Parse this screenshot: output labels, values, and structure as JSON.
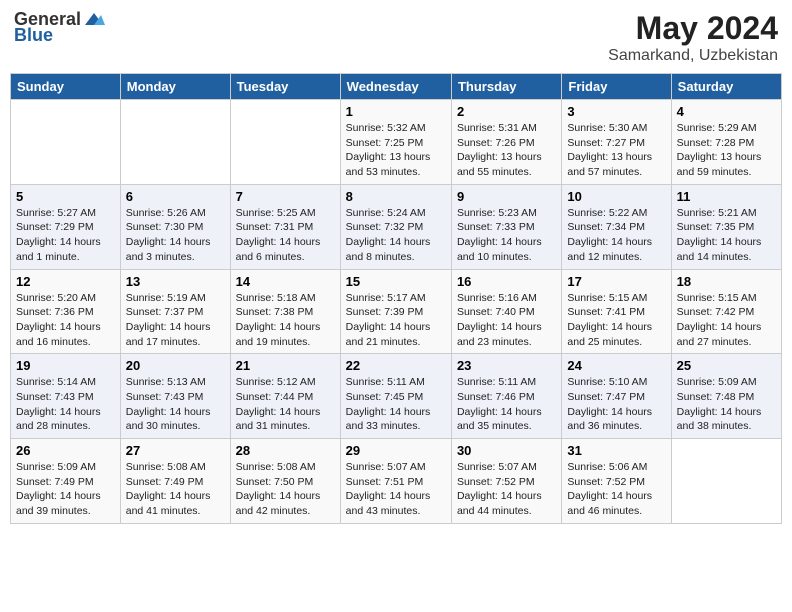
{
  "logo": {
    "general": "General",
    "blue": "Blue"
  },
  "title": "May 2024",
  "location": "Samarkand, Uzbekistan",
  "headers": [
    "Sunday",
    "Monday",
    "Tuesday",
    "Wednesday",
    "Thursday",
    "Friday",
    "Saturday"
  ],
  "weeks": [
    [
      {
        "day": "",
        "sunrise": "",
        "sunset": "",
        "daylight": ""
      },
      {
        "day": "",
        "sunrise": "",
        "sunset": "",
        "daylight": ""
      },
      {
        "day": "",
        "sunrise": "",
        "sunset": "",
        "daylight": ""
      },
      {
        "day": "1",
        "sunrise": "Sunrise: 5:32 AM",
        "sunset": "Sunset: 7:25 PM",
        "daylight": "Daylight: 13 hours and 53 minutes."
      },
      {
        "day": "2",
        "sunrise": "Sunrise: 5:31 AM",
        "sunset": "Sunset: 7:26 PM",
        "daylight": "Daylight: 13 hours and 55 minutes."
      },
      {
        "day": "3",
        "sunrise": "Sunrise: 5:30 AM",
        "sunset": "Sunset: 7:27 PM",
        "daylight": "Daylight: 13 hours and 57 minutes."
      },
      {
        "day": "4",
        "sunrise": "Sunrise: 5:29 AM",
        "sunset": "Sunset: 7:28 PM",
        "daylight": "Daylight: 13 hours and 59 minutes."
      }
    ],
    [
      {
        "day": "5",
        "sunrise": "Sunrise: 5:27 AM",
        "sunset": "Sunset: 7:29 PM",
        "daylight": "Daylight: 14 hours and 1 minute."
      },
      {
        "day": "6",
        "sunrise": "Sunrise: 5:26 AM",
        "sunset": "Sunset: 7:30 PM",
        "daylight": "Daylight: 14 hours and 3 minutes."
      },
      {
        "day": "7",
        "sunrise": "Sunrise: 5:25 AM",
        "sunset": "Sunset: 7:31 PM",
        "daylight": "Daylight: 14 hours and 6 minutes."
      },
      {
        "day": "8",
        "sunrise": "Sunrise: 5:24 AM",
        "sunset": "Sunset: 7:32 PM",
        "daylight": "Daylight: 14 hours and 8 minutes."
      },
      {
        "day": "9",
        "sunrise": "Sunrise: 5:23 AM",
        "sunset": "Sunset: 7:33 PM",
        "daylight": "Daylight: 14 hours and 10 minutes."
      },
      {
        "day": "10",
        "sunrise": "Sunrise: 5:22 AM",
        "sunset": "Sunset: 7:34 PM",
        "daylight": "Daylight: 14 hours and 12 minutes."
      },
      {
        "day": "11",
        "sunrise": "Sunrise: 5:21 AM",
        "sunset": "Sunset: 7:35 PM",
        "daylight": "Daylight: 14 hours and 14 minutes."
      }
    ],
    [
      {
        "day": "12",
        "sunrise": "Sunrise: 5:20 AM",
        "sunset": "Sunset: 7:36 PM",
        "daylight": "Daylight: 14 hours and 16 minutes."
      },
      {
        "day": "13",
        "sunrise": "Sunrise: 5:19 AM",
        "sunset": "Sunset: 7:37 PM",
        "daylight": "Daylight: 14 hours and 17 minutes."
      },
      {
        "day": "14",
        "sunrise": "Sunrise: 5:18 AM",
        "sunset": "Sunset: 7:38 PM",
        "daylight": "Daylight: 14 hours and 19 minutes."
      },
      {
        "day": "15",
        "sunrise": "Sunrise: 5:17 AM",
        "sunset": "Sunset: 7:39 PM",
        "daylight": "Daylight: 14 hours and 21 minutes."
      },
      {
        "day": "16",
        "sunrise": "Sunrise: 5:16 AM",
        "sunset": "Sunset: 7:40 PM",
        "daylight": "Daylight: 14 hours and 23 minutes."
      },
      {
        "day": "17",
        "sunrise": "Sunrise: 5:15 AM",
        "sunset": "Sunset: 7:41 PM",
        "daylight": "Daylight: 14 hours and 25 minutes."
      },
      {
        "day": "18",
        "sunrise": "Sunrise: 5:15 AM",
        "sunset": "Sunset: 7:42 PM",
        "daylight": "Daylight: 14 hours and 27 minutes."
      }
    ],
    [
      {
        "day": "19",
        "sunrise": "Sunrise: 5:14 AM",
        "sunset": "Sunset: 7:43 PM",
        "daylight": "Daylight: 14 hours and 28 minutes."
      },
      {
        "day": "20",
        "sunrise": "Sunrise: 5:13 AM",
        "sunset": "Sunset: 7:43 PM",
        "daylight": "Daylight: 14 hours and 30 minutes."
      },
      {
        "day": "21",
        "sunrise": "Sunrise: 5:12 AM",
        "sunset": "Sunset: 7:44 PM",
        "daylight": "Daylight: 14 hours and 31 minutes."
      },
      {
        "day": "22",
        "sunrise": "Sunrise: 5:11 AM",
        "sunset": "Sunset: 7:45 PM",
        "daylight": "Daylight: 14 hours and 33 minutes."
      },
      {
        "day": "23",
        "sunrise": "Sunrise: 5:11 AM",
        "sunset": "Sunset: 7:46 PM",
        "daylight": "Daylight: 14 hours and 35 minutes."
      },
      {
        "day": "24",
        "sunrise": "Sunrise: 5:10 AM",
        "sunset": "Sunset: 7:47 PM",
        "daylight": "Daylight: 14 hours and 36 minutes."
      },
      {
        "day": "25",
        "sunrise": "Sunrise: 5:09 AM",
        "sunset": "Sunset: 7:48 PM",
        "daylight": "Daylight: 14 hours and 38 minutes."
      }
    ],
    [
      {
        "day": "26",
        "sunrise": "Sunrise: 5:09 AM",
        "sunset": "Sunset: 7:49 PM",
        "daylight": "Daylight: 14 hours and 39 minutes."
      },
      {
        "day": "27",
        "sunrise": "Sunrise: 5:08 AM",
        "sunset": "Sunset: 7:49 PM",
        "daylight": "Daylight: 14 hours and 41 minutes."
      },
      {
        "day": "28",
        "sunrise": "Sunrise: 5:08 AM",
        "sunset": "Sunset: 7:50 PM",
        "daylight": "Daylight: 14 hours and 42 minutes."
      },
      {
        "day": "29",
        "sunrise": "Sunrise: 5:07 AM",
        "sunset": "Sunset: 7:51 PM",
        "daylight": "Daylight: 14 hours and 43 minutes."
      },
      {
        "day": "30",
        "sunrise": "Sunrise: 5:07 AM",
        "sunset": "Sunset: 7:52 PM",
        "daylight": "Daylight: 14 hours and 44 minutes."
      },
      {
        "day": "31",
        "sunrise": "Sunrise: 5:06 AM",
        "sunset": "Sunset: 7:52 PM",
        "daylight": "Daylight: 14 hours and 46 minutes."
      },
      {
        "day": "",
        "sunrise": "",
        "sunset": "",
        "daylight": ""
      }
    ]
  ]
}
